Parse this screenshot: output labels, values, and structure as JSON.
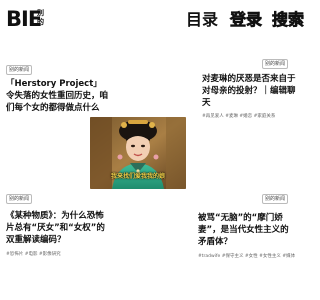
{
  "logo": {
    "main": "BIE",
    "side": "别的"
  },
  "nav": {
    "catalog": "目录",
    "login": "登录",
    "search": "搜索"
  },
  "cards": [
    {
      "tag": "别的新闻",
      "title": "「Herstory Project」令失落的女性重回历史，咱们每个女的都得做点什么",
      "meta": ""
    },
    {
      "tag": "别的新闻",
      "title": "对麦琳的厌恶是否来自于对母亲的投射？｜编辑聊天",
      "meta": "#再见爱人  #麦琳  #婚恋  #家庭关系"
    },
    {
      "tag": "别的新闻",
      "title": "《某种物质》：为什么恐怖片总有“厌女”和“女权”的双重解读编码？",
      "meta": "#恐怖片  #电影  #影像研究"
    },
    {
      "tag": "别的新闻",
      "title": "被骂“无脑”的“摩门娇妻”，是当代女性主义的矛盾体？",
      "meta": "#tradwife  #保守主义  #女性  #女性主义  #媒体"
    }
  ],
  "hero": {
    "caption": "我来找们爱我我的娘"
  },
  "colors": {
    "text": "#111111",
    "logo_stroke": "#111111",
    "caption": "#f2d24a"
  }
}
